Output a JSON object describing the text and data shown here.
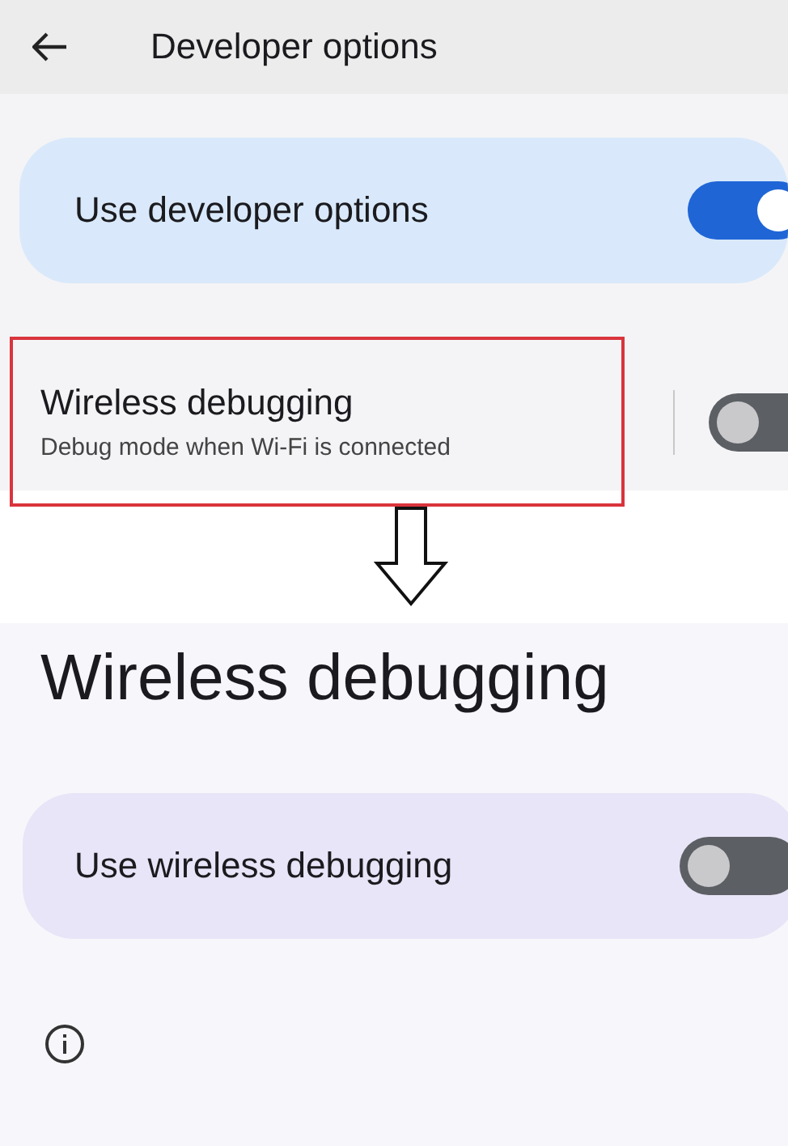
{
  "developer_screen": {
    "title": "Developer options",
    "master_switch": {
      "label": "Use developer options",
      "on": true
    },
    "wireless_item": {
      "label": "Wireless debugging",
      "subtitle": "Debug mode when Wi-Fi is connected",
      "on": false,
      "highlighted": true
    }
  },
  "wireless_screen": {
    "title": "Wireless debugging",
    "switch": {
      "label": "Use wireless debugging",
      "on": false
    }
  }
}
